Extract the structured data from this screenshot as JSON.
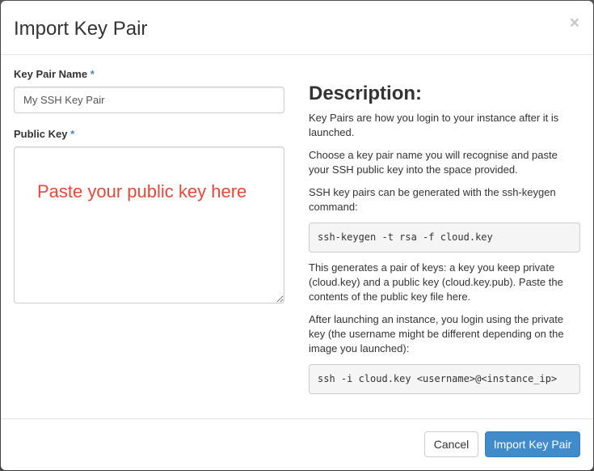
{
  "dialog": {
    "title": "Import Key Pair",
    "close_glyph": "×"
  },
  "form": {
    "key_pair_name": {
      "label": "Key Pair Name",
      "required_marker": "*",
      "placeholder": "My SSH Key Pair"
    },
    "public_key": {
      "label": "Public Key",
      "required_marker": "*",
      "placeholder": "Paste your public key here"
    }
  },
  "description": {
    "title": "Description:",
    "p1": "Key Pairs are how you login to your instance after it is launched.",
    "p2": "Choose a key pair name you will recognise and paste your SSH public key into the space provided.",
    "p3": "SSH key pairs can be generated with the ssh-keygen command:",
    "code1": "ssh-keygen -t rsa -f cloud.key",
    "p4": "This generates a pair of keys: a key you keep private (cloud.key) and a public key (cloud.key.pub). Paste the contents of the public key file here.",
    "p5": "After launching an instance, you login using the private key (the username might be different depending on the image you launched):",
    "code2": "ssh -i cloud.key <username>@<instance_ip>"
  },
  "footer": {
    "cancel_label": "Cancel",
    "submit_label": "Import Key Pair"
  },
  "colors": {
    "primary": "#428bca",
    "required": "#428bca",
    "placeholder_highlight": "#e8473a"
  }
}
